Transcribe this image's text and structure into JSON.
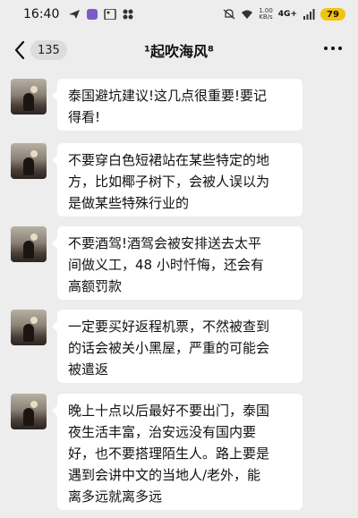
{
  "status_bar": {
    "time": "16:40",
    "net_speed_value": "1.00",
    "net_speed_unit": "KB/s",
    "net_type": "4G+",
    "battery": "79"
  },
  "nav": {
    "unread_count": "135",
    "title": "¹起吹海风⁸"
  },
  "messages": [
    {
      "text": "泰国避坑建议!这几点很重要!要记\n得看!"
    },
    {
      "text": "不要穿白色短裙站在某些特定的地\n方，比如椰子树下，会被人误以为\n是做某些特殊行业的"
    },
    {
      "text": "不要酒驾!酒驾会被安排送去太平\n间做义工，48 小时忏悔，还会有\n高额罚款"
    },
    {
      "text": "一定要买好返程机票，不然被查到\n的话会被关小黑屋，严重的可能会\n被遣返"
    },
    {
      "text": "晚上十点以后最好不要出门，泰国\n夜生活丰富，治安远没有国内要\n好，也不要搭理陌生人。路上要是\n遇到会讲中文的当地人/老外，能\n离多远就离多远"
    }
  ]
}
